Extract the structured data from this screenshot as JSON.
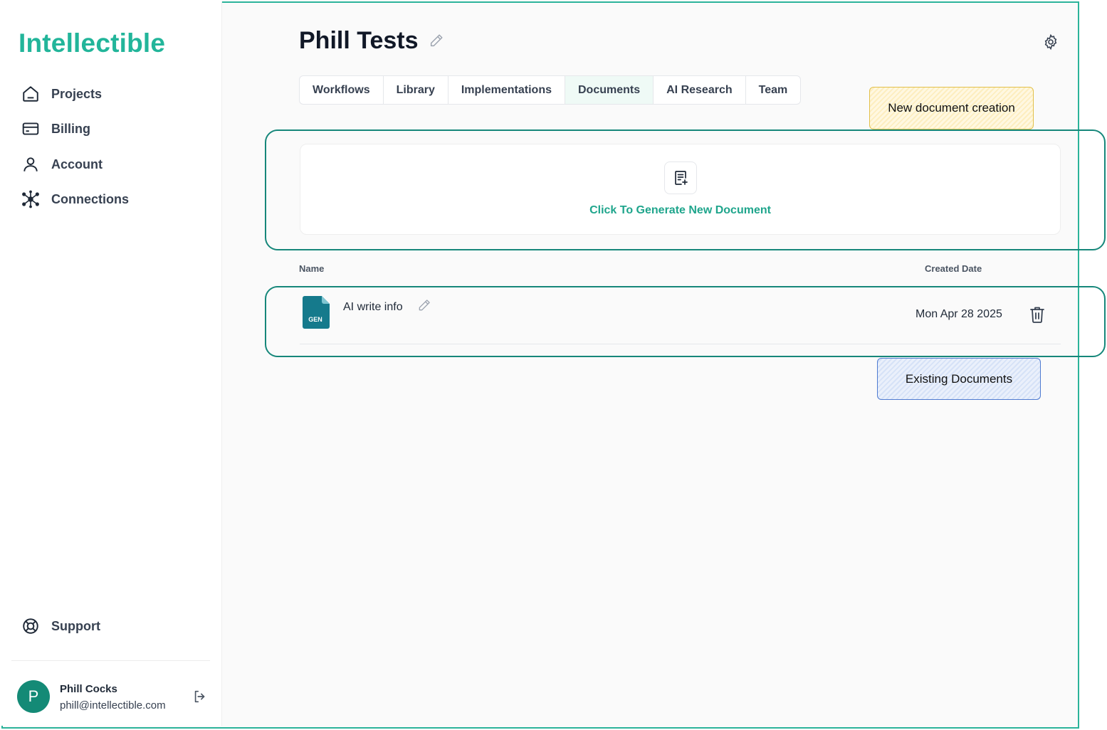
{
  "app": {
    "logo": "Intellectible",
    "accent_color": "#22b59a"
  },
  "sidebar": {
    "items": [
      {
        "label": "Projects",
        "icon": "home-icon"
      },
      {
        "label": "Billing",
        "icon": "credit-card-icon"
      },
      {
        "label": "Account",
        "icon": "user-icon"
      },
      {
        "label": "Connections",
        "icon": "network-icon"
      }
    ],
    "support": {
      "label": "Support",
      "icon": "lifebuoy-icon"
    },
    "user": {
      "initial": "P",
      "name": "Phill Cocks",
      "email": "phill@intellectible.com"
    }
  },
  "header": {
    "title": "Phill Tests"
  },
  "tabs": [
    {
      "label": "Workflows",
      "active": false
    },
    {
      "label": "Library",
      "active": false
    },
    {
      "label": "Implementations",
      "active": false
    },
    {
      "label": "Documents",
      "active": true
    },
    {
      "label": "AI Research",
      "active": false
    },
    {
      "label": "Team",
      "active": false
    }
  ],
  "new_document": {
    "label": "Click To Generate New Document"
  },
  "table": {
    "columns": {
      "name": "Name",
      "created": "Created Date"
    },
    "rows": [
      {
        "file_badge": "GEN",
        "name": "AI write info",
        "created": "Mon Apr 28 2025"
      }
    ]
  },
  "annotations": {
    "new_doc_note": "New document creation",
    "existing_note": "Existing Documents"
  }
}
